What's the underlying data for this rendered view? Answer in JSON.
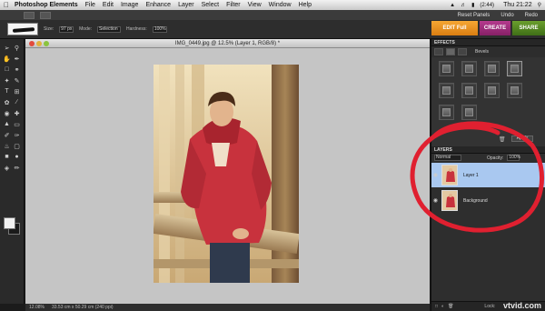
{
  "menubar": {
    "app_name": "Photoshop Elements",
    "items": [
      "File",
      "Edit",
      "Image",
      "Enhance",
      "Layer",
      "Select",
      "Filter",
      "View",
      "Window",
      "Help"
    ],
    "clock": "Thu 21:22",
    "status_extra": "(2:44)"
  },
  "appbar": {
    "reset_panels": "Reset Panels",
    "undo": "Undo",
    "redo": "Redo"
  },
  "options": {
    "size_label": "Size:",
    "size_value": "97 px",
    "mode_label": "Mode:",
    "mode_value": "Selection",
    "hardness_label": "Hardness:",
    "hardness_value": "100%"
  },
  "modes": {
    "edit": "EDIT Full",
    "create": "CREATE",
    "share": "SHARE"
  },
  "document": {
    "title": "IMG_0449.jpg @ 12.5% (Layer 1, RGB/8) *"
  },
  "statusbar": {
    "zoom": "12.08%",
    "doc_size": "33.53 cm x 50.29 cm (240 ppi)"
  },
  "effects": {
    "header": "EFFECTS",
    "preset": "Bevels",
    "apply": "Apply"
  },
  "layers": {
    "header": "LAYERS",
    "blend_mode": "Normal",
    "opacity_label": "Opacity:",
    "opacity_value": "100%",
    "items": [
      {
        "name": "Layer 1"
      },
      {
        "name": "Background"
      }
    ],
    "lock_label": "Lock:"
  },
  "watermark": "vtvid.com",
  "colors": {
    "annotation": "#e02030",
    "selected_layer": "#a9c8f0",
    "edit_orange": "#f0981e",
    "create_purple": "#a3307b",
    "share_green": "#5a8a25"
  }
}
